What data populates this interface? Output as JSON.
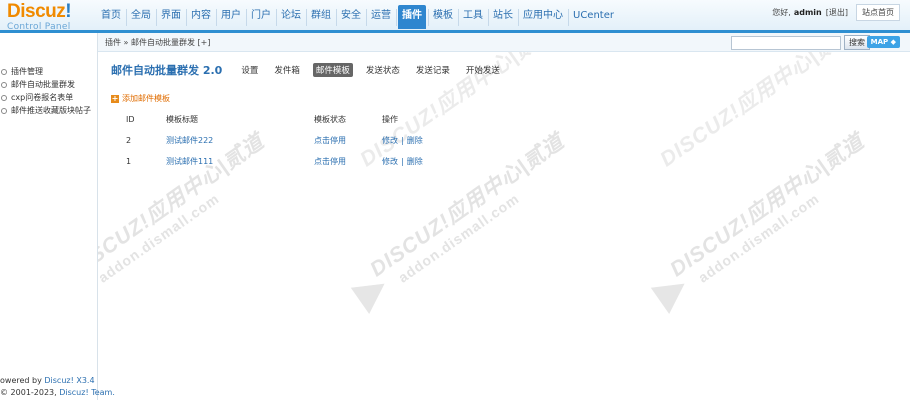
{
  "logo": {
    "brand": "Discuz",
    "bang": "!",
    "subtitle": "Control Panel"
  },
  "nav": [
    "首页",
    "全局",
    "界面",
    "内容",
    "用户",
    "门户",
    "论坛",
    "群组",
    "安全",
    "运营",
    "插件",
    "模板",
    "工具",
    "站长",
    "应用中心",
    "UCenter"
  ],
  "nav_active_index": 10,
  "userbar": {
    "greeting": "您好,",
    "username": "admin",
    "logout": "[退出]",
    "home": "站点首页"
  },
  "breadcrumb": "插件 » 邮件自动批量群发 [+]",
  "search": {
    "value": "",
    "button": "搜索"
  },
  "map_button": "MAP ◆",
  "sidebar": {
    "items": [
      "插件管理",
      "邮件自动批量群发",
      "cxp问卷报名表单",
      "邮件推送收藏版块帖子"
    ]
  },
  "footer": {
    "line1_prefix": "owered by ",
    "line1_link": "Discuz! X3.4",
    "line2_prefix": "© 2001-2023, ",
    "line2_link": "Discuz! Team."
  },
  "page": {
    "title": "邮件自动批量群发 2.0",
    "tabs": [
      "设置",
      "发件箱",
      "邮件模板",
      "发送状态",
      "发送记录",
      "开始发送"
    ],
    "active_tab_index": 2,
    "add_link": "添加邮件模板"
  },
  "table": {
    "headers": [
      "ID",
      "模板标题",
      "模板状态",
      "操作"
    ],
    "rows": [
      {
        "id": "2",
        "title": "测试邮件222",
        "status": "点击停用",
        "edit": "修改",
        "delete": "删除"
      },
      {
        "id": "1",
        "title": "测试邮件111",
        "status": "点击停用",
        "edit": "修改",
        "delete": "删除"
      }
    ]
  },
  "watermark": {
    "line1": "DISCUZ!应用中心|贰道",
    "line2": "addon.dismall.com"
  },
  "colors": {
    "accent": "#2e86cf",
    "brand_orange": "#f08a00",
    "link": "#2b6fb0"
  }
}
